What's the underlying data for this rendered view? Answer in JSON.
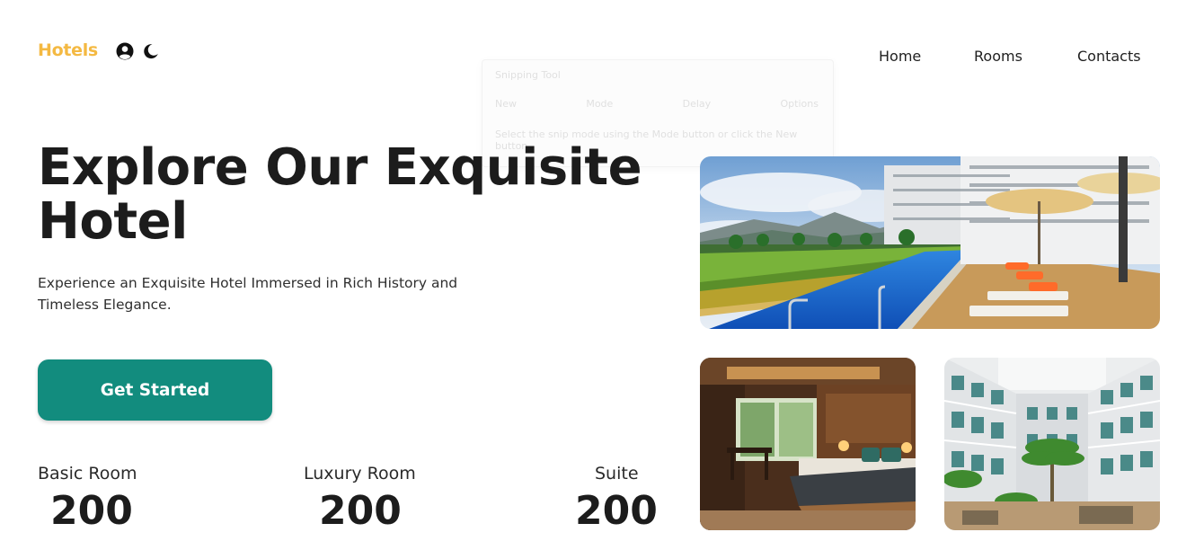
{
  "header": {
    "brand": "Hotels",
    "icons": [
      "user-circle-icon",
      "moon-icon"
    ],
    "nav": [
      "Home",
      "Rooms",
      "Contacts"
    ]
  },
  "hero": {
    "title": "Explore Our Exquisite Hotel",
    "subtitle": "Experience an Exquisite Hotel Immersed in Rich History and Timeless Elegance.",
    "cta_label": "Get Started"
  },
  "stats": [
    {
      "label": "Basic Room",
      "value": "200"
    },
    {
      "label": "Luxury Room",
      "value": "200"
    },
    {
      "label": "Suite",
      "value": "200"
    }
  ],
  "overlay": {
    "title": "Snipping Tool",
    "tools": [
      "New",
      "Mode",
      "Delay",
      "Options"
    ],
    "hint": "Select the snip mode using the Mode button or click the New button."
  },
  "colors": {
    "brand": "#f4b942",
    "accent": "#128c7e",
    "text": "#1c1c1c"
  }
}
